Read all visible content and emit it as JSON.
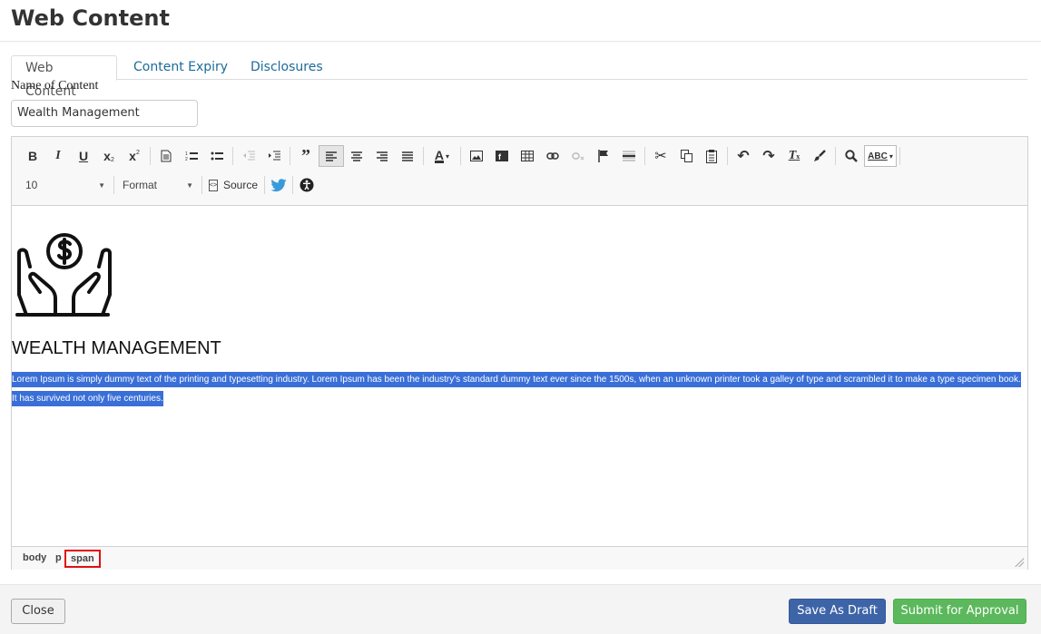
{
  "header": {
    "title": "Web Content"
  },
  "tabs": [
    {
      "label": "Web Content",
      "active": true
    },
    {
      "label": "Content Expiry",
      "active": false
    },
    {
      "label": "Disclosures",
      "active": false
    }
  ],
  "form": {
    "name_label": "Name of Content",
    "name_value": "Wealth Management"
  },
  "toolbar": {
    "font_size": "10",
    "format": "Format",
    "source_label": "Source",
    "spellcheck_label": "ABC"
  },
  "editor": {
    "heading": "WEALTH MANAGEMENT",
    "para_line1": "Lorem Ipsum is simply dummy text of the printing and typesetting industry. Lorem Ipsum has been the industry's standard dummy text ever since the 1500s, when an unknown printer took a galley of type and scrambled it to make a type specimen book.",
    "para_line2": "It has survived not only five centuries."
  },
  "statusbar": {
    "path": [
      "body",
      "p",
      "span"
    ]
  },
  "footer": {
    "close_label": "Close",
    "draft_label": "Save As Draft",
    "submit_label": "Submit for Approval"
  },
  "colors": {
    "selection": "#3a6fd8",
    "primary_button": "#3e64a8",
    "success_button": "#5cb85c",
    "link": "#1d6a9a",
    "highlight_border": "#e01010"
  }
}
